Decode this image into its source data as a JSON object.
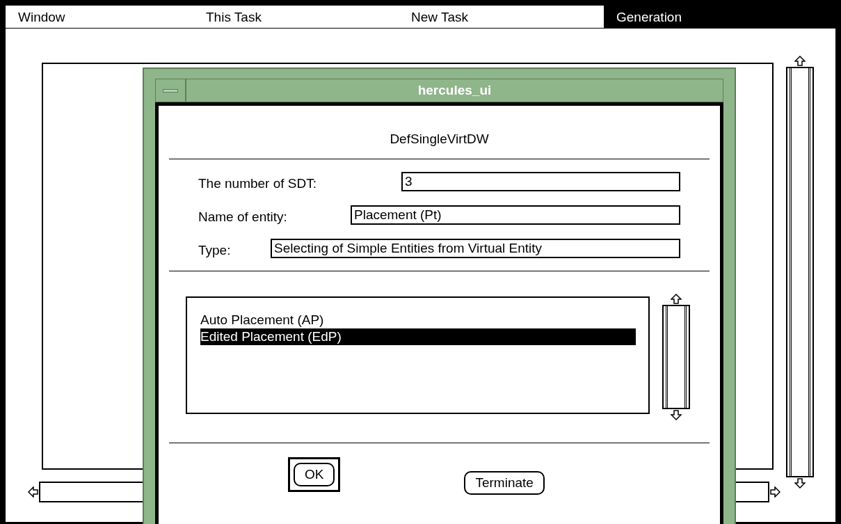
{
  "menu": [
    {
      "label": "Window",
      "selected": false
    },
    {
      "label": "This Task",
      "selected": false
    },
    {
      "label": "New Task",
      "selected": false
    },
    {
      "label": "Generation",
      "selected": true
    }
  ],
  "dialog": {
    "title": "hercules_ui",
    "heading": "DefSingleVirtDW",
    "fields": [
      {
        "label": "The number of SDT:",
        "value": "3"
      },
      {
        "label": "Name of entity:",
        "value": "Placement (Pt)"
      },
      {
        "label": "Type:",
        "value": "Selecting of Simple Entities from Virtual Entity"
      }
    ],
    "list": [
      {
        "label": "Auto Placement (AP)",
        "selected": false
      },
      {
        "label": "Edited Placement (EdP)",
        "selected": true
      }
    ],
    "buttons": [
      {
        "label": "OK",
        "default": true
      },
      {
        "label": "Terminate",
        "default": false
      }
    ]
  }
}
